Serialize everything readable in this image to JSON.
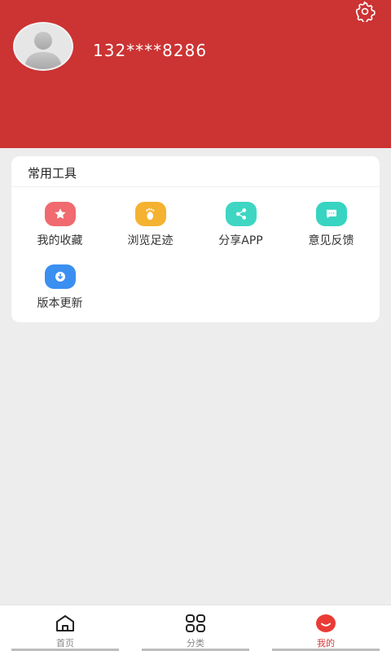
{
  "profile": {
    "phone": "132****8286"
  },
  "tools_card": {
    "title": "常用工具",
    "items": [
      {
        "label": "我的收藏",
        "icon": "star-icon",
        "color": "#f06a6f"
      },
      {
        "label": "浏览足迹",
        "icon": "footprint-icon",
        "color": "#f5b230"
      },
      {
        "label": "分享APP",
        "icon": "share-icon",
        "color": "#3ed6c3"
      },
      {
        "label": "意见反馈",
        "icon": "message-icon",
        "color": "#36d4c1"
      },
      {
        "label": "版本更新",
        "icon": "download-icon",
        "color": "#3b8ff0"
      }
    ]
  },
  "tabbar": {
    "tabs": [
      {
        "label": "首页",
        "icon": "home-icon"
      },
      {
        "label": "分类",
        "icon": "grid-icon"
      },
      {
        "label": "我的",
        "icon": "smile-icon"
      }
    ],
    "active_index": 2
  },
  "colors": {
    "header": "#cc3333",
    "active_tab": "#d83a3a"
  }
}
